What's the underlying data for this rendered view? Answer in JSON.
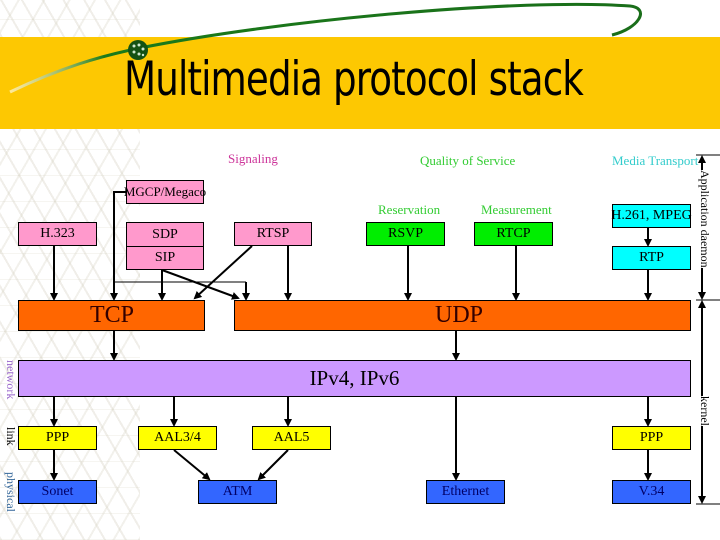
{
  "title": "Multimedia protocol stack",
  "colors": {
    "title_band": "#fdc802",
    "signaling": "#ff99cc",
    "qos": "#00ee00",
    "media": "#00ffff",
    "transport": "#ff6600",
    "network": "#cc99ff",
    "link": "#ffff00",
    "physical": "#3366ff"
  },
  "categories": {
    "signaling": "Signaling",
    "qos": "Quality of Service",
    "media": "Media Transport",
    "reservation": "Reservation",
    "measurement": "Measurement"
  },
  "boxes": {
    "mgcp": "MGCP/Megaco",
    "h323": "H.323",
    "sdp": "SDP",
    "sip": "SIP",
    "rtsp": "RTSP",
    "rsvp": "RSVP",
    "rtcp": "RTCP",
    "h261": "H.261, MPEG",
    "rtp": "RTP",
    "tcp": "TCP",
    "udp": "UDP",
    "ip": "IPv4, IPv6",
    "ppp_left": "PPP",
    "aal34": "AAL3/4",
    "aal5": "AAL5",
    "ppp_right": "PPP",
    "sonet": "Sonet",
    "atm": "ATM",
    "ethernet": "Ethernet",
    "v34": "V.34"
  },
  "side_labels": {
    "app_daemon": "Application daemon",
    "kernel": "kernel",
    "network": "network",
    "link": "link",
    "physical": "physical"
  }
}
